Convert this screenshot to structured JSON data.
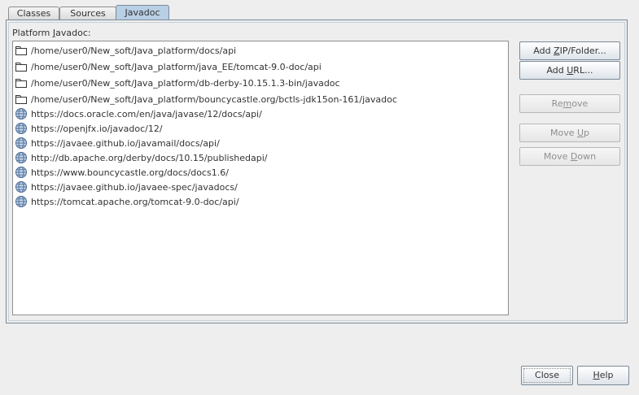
{
  "tabs": [
    {
      "label": "Classes",
      "active": false
    },
    {
      "label": "Sources",
      "active": false
    },
    {
      "label": "Javadoc",
      "active": true
    }
  ],
  "platform_label": {
    "before": "Platform ",
    "mnemonic": "J",
    "after": "avadoc:"
  },
  "javadoc_list": [
    {
      "icon": "folder-icon",
      "text": "/home/user0/New_soft/Java_platform/docs/api"
    },
    {
      "icon": "folder-icon",
      "text": "/home/user0/New_soft/Java_platform/java_EE/tomcat-9.0-doc/api"
    },
    {
      "icon": "folder-icon",
      "text": "/home/user0/New_soft/Java_platform/db-derby-10.15.1.3-bin/javadoc"
    },
    {
      "icon": "folder-icon",
      "text": "/home/user0/New_soft/Java_platform/bouncycastle.org/bctls-jdk15on-161/javadoc"
    },
    {
      "icon": "globe-icon",
      "text": "https://docs.oracle.com/en/java/javase/12/docs/api/"
    },
    {
      "icon": "globe-icon",
      "text": "https://openjfx.io/javadoc/12/"
    },
    {
      "icon": "globe-icon",
      "text": "https://javaee.github.io/javamail/docs/api/"
    },
    {
      "icon": "globe-icon",
      "text": "http://db.apache.org/derby/docs/10.15/publishedapi/"
    },
    {
      "icon": "globe-icon",
      "text": "https://www.bouncycastle.org/docs/docs1.6/"
    },
    {
      "icon": "globe-icon",
      "text": "https://javaee.github.io/javaee-spec/javadocs/"
    },
    {
      "icon": "globe-icon",
      "text": "https://tomcat.apache.org/tomcat-9.0-doc/api/"
    }
  ],
  "buttons": {
    "add_zip": {
      "before": "Add ",
      "mnemonic": "Z",
      "after": "IP/Folder...",
      "enabled": true
    },
    "add_url": {
      "before": "Add ",
      "mnemonic": "U",
      "after": "RL...",
      "enabled": true
    },
    "remove": {
      "before": "Re",
      "mnemonic": "m",
      "after": "ove",
      "enabled": false
    },
    "move_up": {
      "before": "Move ",
      "mnemonic": "U",
      "after": "p",
      "enabled": false
    },
    "move_down": {
      "before": "Move ",
      "mnemonic": "D",
      "after": "own",
      "enabled": false
    },
    "close": {
      "label": "Close"
    },
    "help": {
      "before": "",
      "mnemonic": "H",
      "after": "elp"
    }
  },
  "colors": {
    "active_tab": "#b8cfe5",
    "border": "#7a8a99",
    "background": "#eeeeee"
  }
}
